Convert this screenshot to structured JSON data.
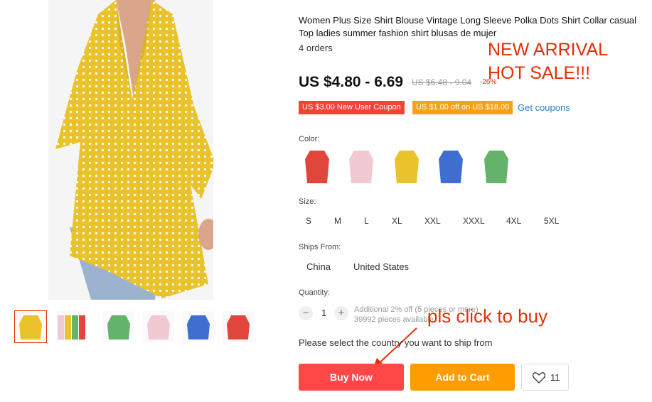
{
  "product": {
    "title": "Women Plus Size Shirt Blouse Vintage Long Sleeve Polka Dots Shirt Collar casual Top ladies summer fashion shirt blusas de mujer",
    "orders": "4 orders",
    "price": "US $4.80 - 6.69",
    "original_price": "US $6.48 - 9.04",
    "discount": "-26%"
  },
  "promo": {
    "banner_line1": "NEW ARRIVAL",
    "banner_line2": "HOT SALE!!!",
    "click_note": "pls click to buy"
  },
  "coupons": {
    "new_user": "US $3.00 New User Coupon",
    "store": "US $1.00 off on US $18.00",
    "get_link": "Get coupons"
  },
  "color": {
    "label": "Color:",
    "options": [
      "red",
      "pink",
      "yellow",
      "blue",
      "green"
    ],
    "hex": [
      "#e0463c",
      "#f0c9d2",
      "#e9c22c",
      "#3e6fd0",
      "#64b36a"
    ]
  },
  "size": {
    "label": "Size:",
    "options": [
      "S",
      "M",
      "L",
      "XL",
      "XXL",
      "XXXL",
      "4XL",
      "5XL"
    ]
  },
  "ships_from": {
    "label": "Ships From:",
    "options": [
      "China",
      "United States"
    ]
  },
  "quantity": {
    "label": "Quantity:",
    "value": "1",
    "minus": "−",
    "plus": "+",
    "note_line1": "Additional 2% off (5 pieces or more)",
    "note_line2": "39992 pieces available"
  },
  "country_note": "Please select the country you want to ship from",
  "actions": {
    "buy_now": "Buy Now",
    "add_to_cart": "Add to Cart",
    "wishlist_count": "11"
  },
  "colors": {
    "accent_red": "#e62e04",
    "buy_button": "#ff4747",
    "cart_button": "#ff9c00",
    "link_blue": "#2a81c7",
    "shirt_yellow": "#e9c22c"
  }
}
